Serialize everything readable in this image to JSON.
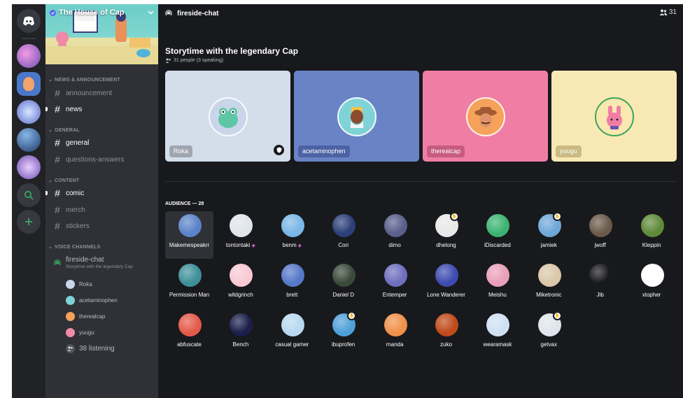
{
  "server": {
    "name": "The House of Cap"
  },
  "sidebar": {
    "categories": {
      "news": "NEWS & ANNOUNCEMENT",
      "general": "GENERAL",
      "content": "CONTENT",
      "voice": "VOICE CHANNELS"
    },
    "channels": {
      "announcement": "announcement",
      "news": "news",
      "general": "general",
      "questions": "questions-answers",
      "comic": "comic",
      "merch": "merch",
      "stickers": "stickers"
    },
    "voice_channel": {
      "name": "fireside-chat",
      "topic": "Storytime with the legendary Cap",
      "users": [
        "Roka",
        "acetaminophen",
        "therealcap",
        "yuugu"
      ],
      "listening": "38 listening"
    }
  },
  "topbar": {
    "channel_name": "fireside-chat",
    "listener_count": "31"
  },
  "stage": {
    "topic": "Storytime with the legendary Cap",
    "people": "31 people (3 speaking)",
    "speakers": [
      {
        "name": "Roka",
        "bg": "#d4deeb",
        "avatar_bg": "#c9d6ea"
      },
      {
        "name": "acetaminophen",
        "bg": "#6a83c6",
        "avatar_bg": "#7fd3d6"
      },
      {
        "name": "therealcap",
        "bg": "#f07ea4",
        "avatar_bg": "#f6a25a"
      },
      {
        "name": "yuugu",
        "bg": "#f8e9b4",
        "avatar_bg": "#fbe7b0"
      }
    ]
  },
  "audience": {
    "header": "AUDIENCE — 28",
    "members": [
      {
        "name": "Makemespeakrr",
        "color": "#5b83c9"
      },
      {
        "name": "tontontaki",
        "color": "#dfe5ec",
        "boost": true
      },
      {
        "name": "benm",
        "color": "#7ab6e6",
        "boost": true
      },
      {
        "name": "Cori",
        "color": "#2c3f78"
      },
      {
        "name": "dimo",
        "color": "#5a5f8c"
      },
      {
        "name": "dhelong",
        "color": "#e8e8e8",
        "hand": true
      },
      {
        "name": "iDiscarded",
        "color": "#3cb371"
      },
      {
        "name": "jamiek",
        "color": "#6fa7d8",
        "hand": true
      },
      {
        "name": "jwoff",
        "color": "#6b5a4a"
      },
      {
        "name": "Kleppin",
        "color": "#5f8a3a"
      },
      {
        "name": "Permission Man",
        "color": "#3f8f9a"
      },
      {
        "name": "wildgrinch",
        "color": "#f7c9d3"
      },
      {
        "name": "brett",
        "color": "#5578c9"
      },
      {
        "name": "Daniel D",
        "color": "#3a4a3a"
      },
      {
        "name": "Entemper",
        "color": "#6f6fbf"
      },
      {
        "name": "Lone Wanderer",
        "color": "#3e4bb0"
      },
      {
        "name": "Meishu",
        "color": "#e8a0b8"
      },
      {
        "name": "Miketronic",
        "color": "#d9c7a8"
      },
      {
        "name": "Jib",
        "color": "#18191c"
      },
      {
        "name": "xtopher",
        "color": "#ffffff"
      },
      {
        "name": "abfuscate",
        "color": "#e45a4a"
      },
      {
        "name": "Bench",
        "color": "#1b1f4a"
      },
      {
        "name": "casual gamer",
        "color": "#b8d8f0"
      },
      {
        "name": "ibuprofen",
        "color": "#4fa0d8",
        "hand": true
      },
      {
        "name": "rnanda",
        "color": "#f0904a"
      },
      {
        "name": "zuko",
        "color": "#c04a1a"
      },
      {
        "name": "wearamask",
        "color": "#cfe0f2"
      },
      {
        "name": "getvax",
        "color": "#dfe5ec",
        "hand": true
      }
    ]
  }
}
